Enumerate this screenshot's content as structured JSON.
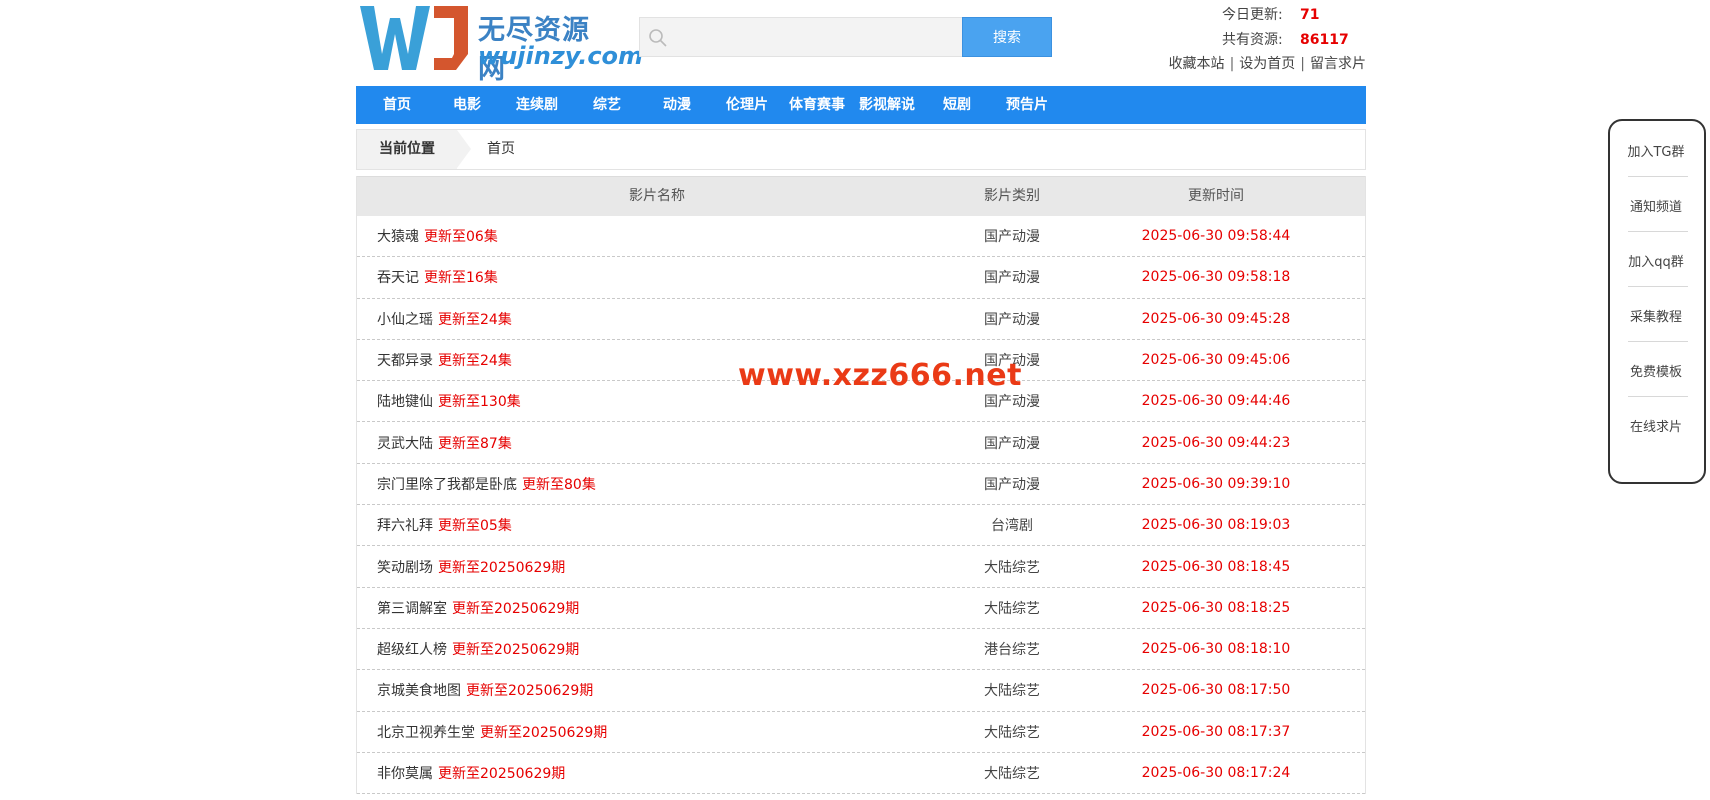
{
  "header": {
    "logo_cn": "无尽资源网",
    "logo_en": "wujinzy.com",
    "search_placeholder": "",
    "search_button": "搜索",
    "today_label": "今日更新:",
    "today_value": "71",
    "total_label": "共有资源:",
    "total_value": "86117",
    "links": [
      "收藏本站",
      "设为首页",
      "留言求片"
    ]
  },
  "nav": [
    "首页",
    "电影",
    "连续剧",
    "综艺",
    "动漫",
    "伦理片",
    "体育赛事",
    "影视解说",
    "短剧",
    "预告片"
  ],
  "breadcrumb": {
    "label": "当前位置",
    "home": "首页"
  },
  "table": {
    "headers": {
      "name": "影片名称",
      "type": "影片类别",
      "time": "更新时间"
    },
    "rows": [
      {
        "title": "大猿魂",
        "update": "更新至06集",
        "type": "国产动漫",
        "time": "2025-06-30 09:58:44"
      },
      {
        "title": "吞天记",
        "update": "更新至16集",
        "type": "国产动漫",
        "time": "2025-06-30 09:58:18"
      },
      {
        "title": "小仙之瑶",
        "update": "更新至24集",
        "type": "国产动漫",
        "time": "2025-06-30 09:45:28"
      },
      {
        "title": "天都异录",
        "update": "更新至24集",
        "type": "国产动漫",
        "time": "2025-06-30 09:45:06"
      },
      {
        "title": "陆地键仙",
        "update": "更新至130集",
        "type": "国产动漫",
        "time": "2025-06-30 09:44:46"
      },
      {
        "title": "灵武大陆",
        "update": "更新至87集",
        "type": "国产动漫",
        "time": "2025-06-30 09:44:23"
      },
      {
        "title": "宗门里除了我都是卧底",
        "update": "更新至80集",
        "type": "国产动漫",
        "time": "2025-06-30 09:39:10"
      },
      {
        "title": "拜六礼拜",
        "update": "更新至05集",
        "type": "台湾剧",
        "time": "2025-06-30 08:19:03"
      },
      {
        "title": "笑动剧场",
        "update": "更新至20250629期",
        "type": "大陆综艺",
        "time": "2025-06-30 08:18:45"
      },
      {
        "title": "第三调解室",
        "update": "更新至20250629期",
        "type": "大陆综艺",
        "time": "2025-06-30 08:18:25"
      },
      {
        "title": "超级红人榜",
        "update": "更新至20250629期",
        "type": "港台综艺",
        "time": "2025-06-30 08:18:10"
      },
      {
        "title": "京城美食地图",
        "update": "更新至20250629期",
        "type": "大陆综艺",
        "time": "2025-06-30 08:17:50"
      },
      {
        "title": "北京卫视养生堂",
        "update": "更新至20250629期",
        "type": "大陆综艺",
        "time": "2025-06-30 08:17:37"
      },
      {
        "title": "非你莫属",
        "update": "更新至20250629期",
        "type": "大陆综艺",
        "time": "2025-06-30 08:17:24"
      }
    ]
  },
  "watermark": "www.xzz666.net",
  "side_panel": [
    "加入TG群",
    "通知频道",
    "加入qq群",
    "采集教程",
    "免费模板",
    "在线求片"
  ]
}
